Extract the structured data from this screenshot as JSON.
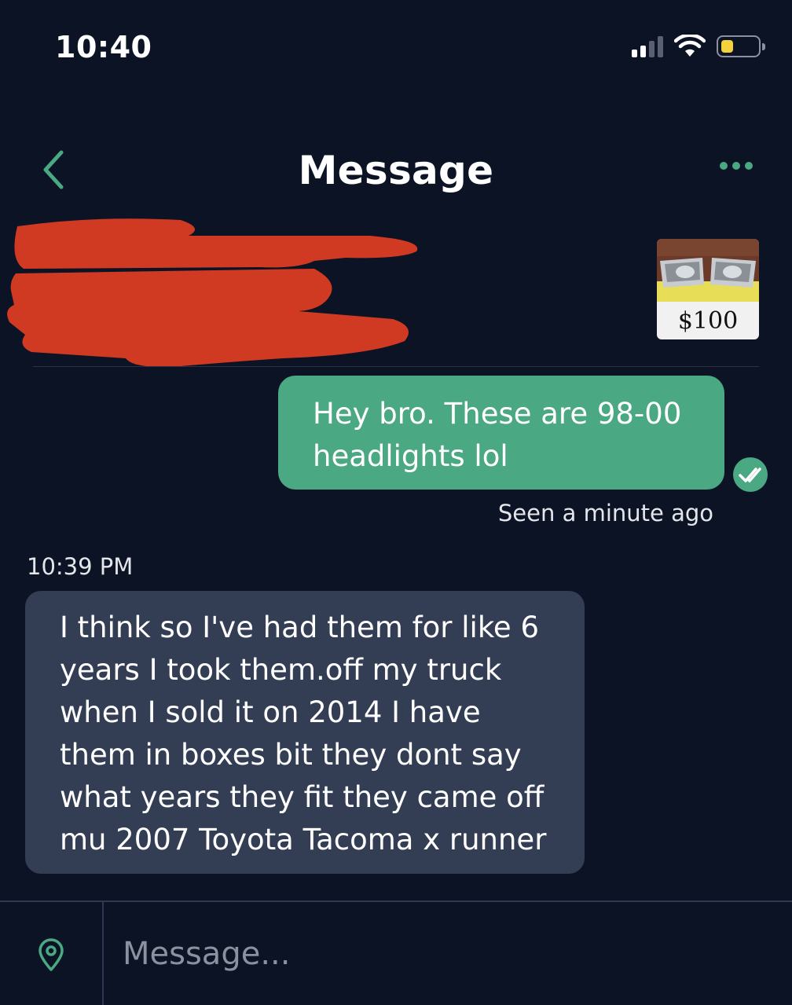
{
  "status_bar": {
    "time": "10:40",
    "signal_bars_active": 2,
    "signal_bars_total": 4,
    "battery_level": 0.35,
    "battery_color": "#f3d23b"
  },
  "header": {
    "title": "Message",
    "back_icon": "chevron-left-icon",
    "more_icon": "more-dots-icon"
  },
  "listing": {
    "price": "$100",
    "info_redacted": true
  },
  "conversation": {
    "outgoing": {
      "text": "Hey bro. These are 98-00\nheadlights lol",
      "read_icon": "double-check-icon",
      "seen_status": "Seen a minute ago"
    },
    "incoming": {
      "time": "10:39 PM",
      "text": "I think so I've had them for like 6\nyears I took them.off my truck\nwhen I sold it on 2014 I have\nthem in boxes bit they dont say\nwhat years  they fit  they came off\nmu 2007 Toyota Tacoma x runner"
    }
  },
  "composer": {
    "placeholder": "Message...",
    "value": "",
    "location_icon": "location-pin-icon"
  },
  "colors": {
    "background": "#0b1325",
    "accent": "#4aa883",
    "incoming_bubble": "#333e55",
    "redaction": "#d13a22"
  }
}
